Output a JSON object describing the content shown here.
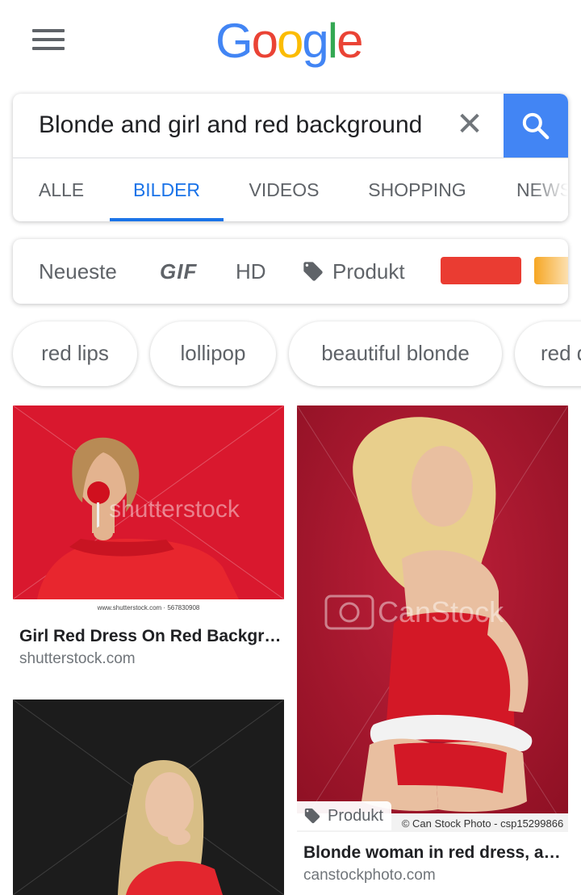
{
  "logo": {
    "letters": [
      "G",
      "o",
      "o",
      "g",
      "l",
      "e"
    ]
  },
  "search": {
    "query": "Blonde and girl and red background",
    "clear_glyph": "✕"
  },
  "tabs": [
    {
      "label": "ALLE",
      "active": false
    },
    {
      "label": "BILDER",
      "active": true
    },
    {
      "label": "VIDEOS",
      "active": false
    },
    {
      "label": "SHOPPING",
      "active": false
    },
    {
      "label": "NEWS",
      "active": false
    }
  ],
  "filters": {
    "newest": "Neueste",
    "gif": "GIF",
    "hd": "HD",
    "product": "Produkt",
    "color_swatches": [
      "#EA3C32",
      "#F6A623"
    ]
  },
  "related_searches": [
    "red lips",
    "lollipop",
    "beautiful blonde",
    "red d"
  ],
  "results": [
    {
      "title": "Girl Red Dress On Red Backgr…",
      "domain": "shutterstock.com",
      "watermark": "shutterstock",
      "caption": "www.shutterstock.com · 567830908"
    },
    {
      "title": "Blonde woman in red dress, a…",
      "domain": "canstockphoto.com",
      "watermark": "CanStock",
      "caption": "© Can Stock Photo - csp15299866",
      "badge": "Produkt"
    },
    {
      "title": "",
      "domain": ""
    }
  ],
  "colors": {
    "accent": "#1a73e8",
    "search_button": "#4285F4",
    "text_secondary": "#5f6368"
  }
}
